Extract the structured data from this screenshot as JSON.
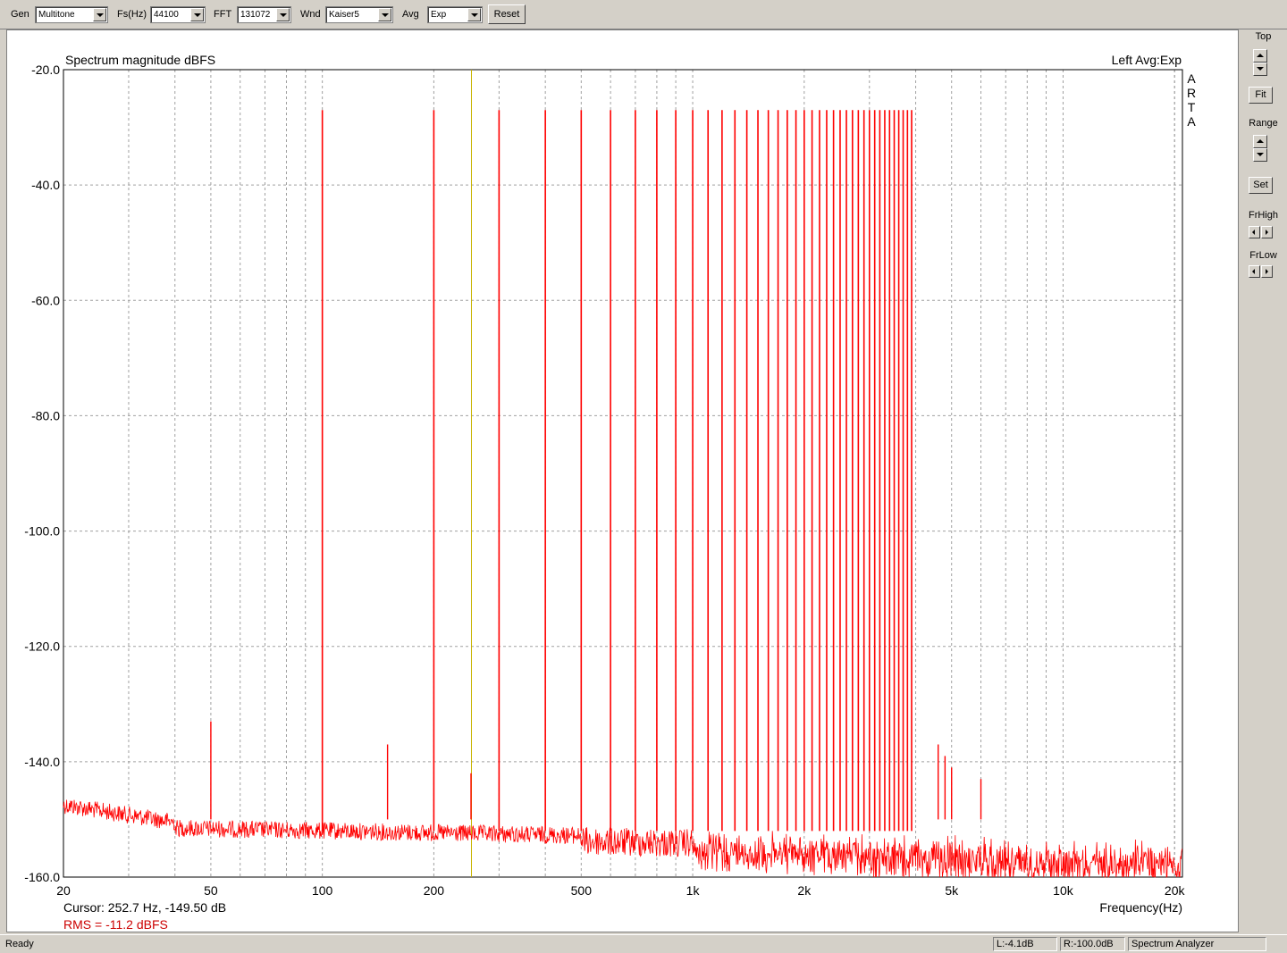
{
  "toolbar": {
    "gen_label": "Gen",
    "gen_value": "Multitone",
    "fs_label": "Fs(Hz)",
    "fs_value": "44100",
    "fft_label": "FFT",
    "fft_value": "131072",
    "wnd_label": "Wnd",
    "wnd_value": "Kaiser5",
    "avg_label": "Avg",
    "avg_value": "Exp",
    "reset_label": "Reset"
  },
  "side": {
    "top_label": "Top",
    "fit_label": "Fit",
    "range_label": "Range",
    "set_label": "Set",
    "frhigh_label": "FrHigh",
    "frlow_label": "FrLow"
  },
  "plot": {
    "title": "Spectrum magnitude dBFS",
    "channel_info": "Left  Avg:Exp",
    "brand_letters": [
      "A",
      "R",
      "T",
      "A"
    ],
    "cursor_text": "Cursor:   252.7 Hz, -149.50 dB",
    "rms_text": "RMS =  -11.2 dBFS",
    "xlabel": "Frequency(Hz)"
  },
  "status": {
    "ready": "Ready",
    "left_level": "L:-4.1dB",
    "right_level": "R:-100.0dB",
    "mode": "Spectrum Analyzer"
  },
  "colors": {
    "trace": "#ff0000",
    "cursor": "#c8b400",
    "grid": "#a0a0a0",
    "rms": "#cc0000"
  },
  "chart_data": {
    "type": "line",
    "title": "Spectrum magnitude dBFS",
    "xlabel": "Frequency(Hz)",
    "ylabel": "",
    "x_scale": "log",
    "xlim": [
      20,
      21000
    ],
    "ylim": [
      -160,
      -20
    ],
    "y_ticks": [
      -20,
      -40,
      -60,
      -80,
      -100,
      -120,
      -140,
      -160
    ],
    "y_tick_labels": [
      "-20.0",
      "-40.0",
      "-60.0",
      "-80.0",
      "-100.0",
      "-120.0",
      "-140.0",
      "-160.0"
    ],
    "x_ticks": [
      20,
      50,
      100,
      200,
      500,
      1000,
      2000,
      5000,
      10000,
      20000
    ],
    "x_tick_labels": [
      "20",
      "50",
      "100",
      "200",
      "500",
      "1k",
      "2k",
      "5k",
      "10k",
      "20k"
    ],
    "grid": true,
    "cursor_hz": 252.7,
    "noise_floor_db": -152,
    "tone_peaks_hz": [
      100,
      200,
      300,
      400,
      500,
      600,
      700,
      800,
      900,
      1000,
      1100,
      1200,
      1300,
      1400,
      1500,
      1600,
      1700,
      1800,
      1900,
      2000,
      2100,
      2200,
      2300,
      2400,
      2500,
      2600,
      2700,
      2800,
      2900,
      3000,
      3100,
      3200,
      3300,
      3400,
      3500,
      3600,
      3700,
      3800,
      3900
    ],
    "tone_peaks_db": -27,
    "spurs": [
      {
        "hz": 50,
        "db": -133
      },
      {
        "hz": 150,
        "db": -137
      },
      {
        "hz": 252,
        "db": -142
      },
      {
        "hz": 4600,
        "db": -137
      },
      {
        "hz": 4800,
        "db": -139
      },
      {
        "hz": 5000,
        "db": -141
      },
      {
        "hz": 6000,
        "db": -143
      }
    ]
  }
}
